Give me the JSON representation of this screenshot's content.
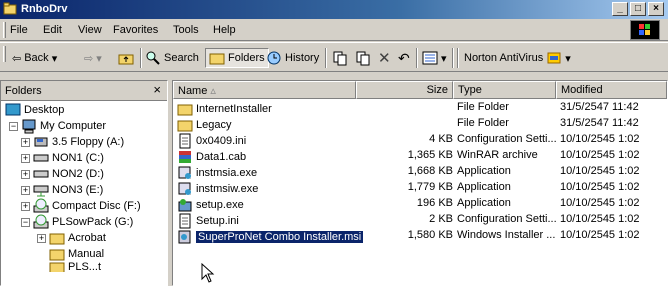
{
  "window": {
    "title": "RnboDrv"
  },
  "menu": [
    "File",
    "Edit",
    "View",
    "Favorites",
    "Tools",
    "Help"
  ],
  "toolbar": {
    "back": "Back",
    "search": "Search",
    "folders": "Folders",
    "history": "History",
    "norton": "Norton AntiVirus"
  },
  "left_pane": {
    "header": "Folders",
    "close": "×",
    "tree": [
      {
        "label": "Desktop",
        "icon": "desktop-icon"
      },
      {
        "label": "My Computer",
        "icon": "computer-icon",
        "exp": "−"
      },
      {
        "label": "3.5 Floppy (A:)",
        "icon": "floppy-icon",
        "exp": "+"
      },
      {
        "label": "NON1 (C:)",
        "icon": "drive-icon",
        "exp": "+"
      },
      {
        "label": "NON2 (D:)",
        "icon": "drive-icon",
        "exp": "+"
      },
      {
        "label": "NON3 (E:)",
        "icon": "drive-icon",
        "exp": "+"
      },
      {
        "label": "Compact Disc (F:)",
        "icon": "cd-icon",
        "exp": "+"
      },
      {
        "label": "PLSowPack (G:)",
        "icon": "cd-icon",
        "exp": "−"
      },
      {
        "label": "Acrobat",
        "icon": "folder-icon",
        "exp": "+"
      },
      {
        "label": "Manual",
        "icon": "folder-icon"
      },
      {
        "label": "PLS...t",
        "icon": "folder-icon"
      }
    ]
  },
  "columns": {
    "name": "Name",
    "size": "Size",
    "type": "Type",
    "modified": "Modified"
  },
  "files": [
    {
      "name": "InternetInstaller",
      "size": "",
      "type": "File Folder",
      "modified": "31/5/2547 11:42",
      "icon": "folder-icon"
    },
    {
      "name": "Legacy",
      "size": "",
      "type": "File Folder",
      "modified": "31/5/2547 11:42",
      "icon": "folder-icon"
    },
    {
      "name": "0x0409.ini",
      "size": "4 KB",
      "type": "Configuration Setti...",
      "modified": "10/10/2545 1:02",
      "icon": "ini-icon"
    },
    {
      "name": "Data1.cab",
      "size": "1,365 KB",
      "type": "WinRAR archive",
      "modified": "10/10/2545 1:02",
      "icon": "archive-icon"
    },
    {
      "name": "instmsia.exe",
      "size": "1,668 KB",
      "type": "Application",
      "modified": "10/10/2545 1:02",
      "icon": "installer-icon"
    },
    {
      "name": "instmsiw.exe",
      "size": "1,779 KB",
      "type": "Application",
      "modified": "10/10/2545 1:02",
      "icon": "installer-icon"
    },
    {
      "name": "setup.exe",
      "size": "196 KB",
      "type": "Application",
      "modified": "10/10/2545 1:02",
      "icon": "setup-icon"
    },
    {
      "name": "Setup.ini",
      "size": "2 KB",
      "type": "Configuration Setti...",
      "modified": "10/10/2545 1:02",
      "icon": "ini-icon"
    },
    {
      "name": "SuperProNet Combo Installer.msi",
      "size": "1,580 KB",
      "type": "Windows Installer ...",
      "modified": "10/10/2545 1:02",
      "icon": "msi-icon",
      "selected": true
    }
  ]
}
